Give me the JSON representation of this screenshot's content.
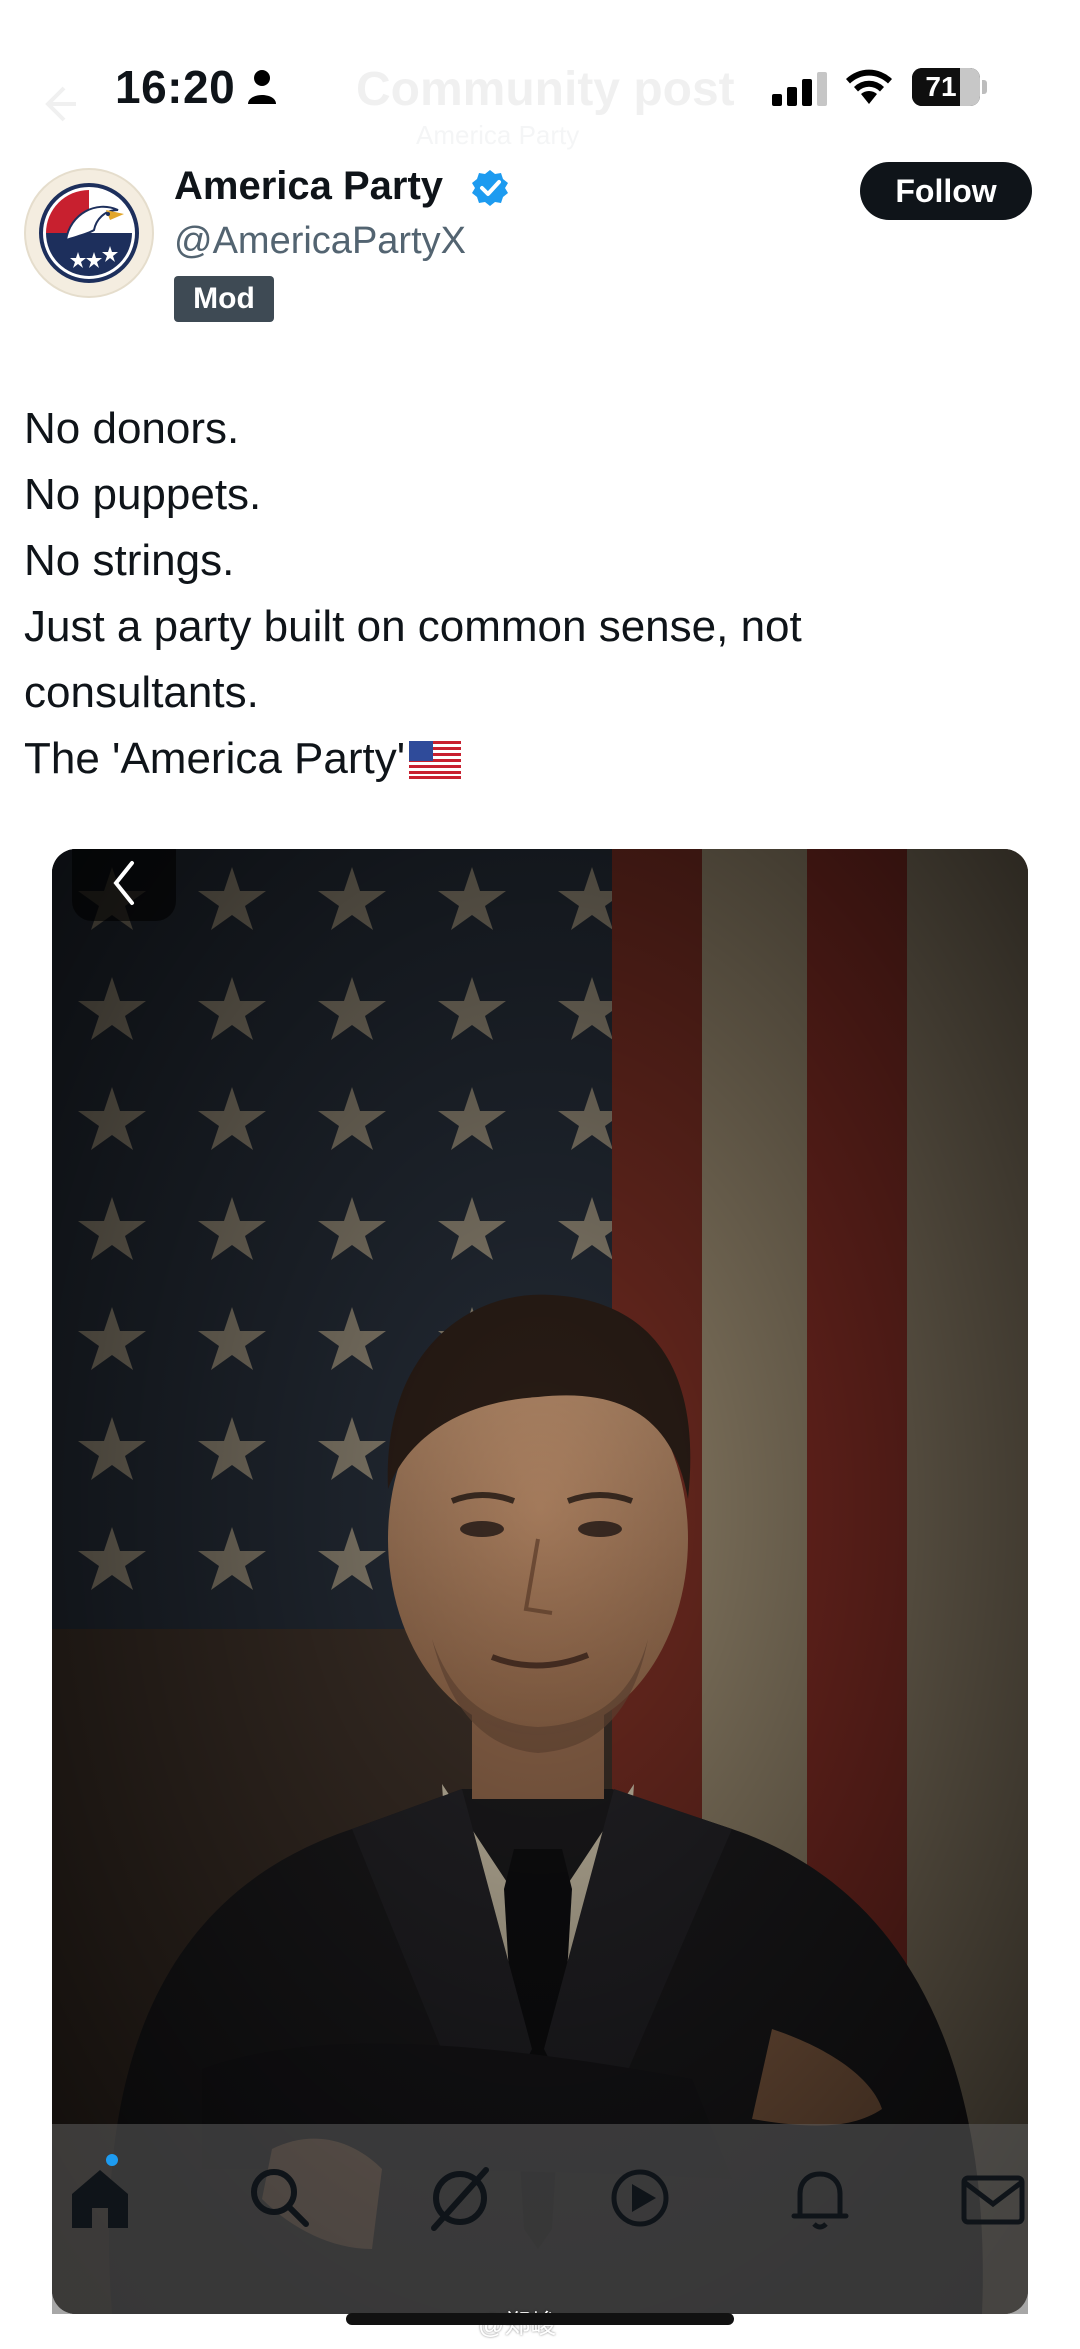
{
  "status_bar": {
    "time": "16:20",
    "battery": "71",
    "battery_level": 0.71
  },
  "nav": {
    "title": "Community post",
    "subtitle": "America Party"
  },
  "post": {
    "display_name": "America Party",
    "handle": "@AmericaPartyX",
    "badge": "Mod",
    "follow_label": "Follow",
    "lines": [
      "No donors.",
      "No puppets.",
      "No strings.",
      "Just a party built on common sense, not",
      "consultants.",
      "The 'America Party'"
    ],
    "flag_emoji": "us-flag-icon"
  },
  "media": {
    "icon": "chevron-left-icon"
  },
  "tabs": [
    {
      "name": "home-icon"
    },
    {
      "name": "search-icon"
    },
    {
      "name": "grok-icon"
    },
    {
      "name": "play-icon"
    },
    {
      "name": "bell-icon"
    },
    {
      "name": "mail-icon"
    }
  ],
  "watermark": "@郑峻",
  "colors": {
    "accent": "#1d9bf0",
    "text": "#0f1419",
    "secondary": "#536471"
  }
}
